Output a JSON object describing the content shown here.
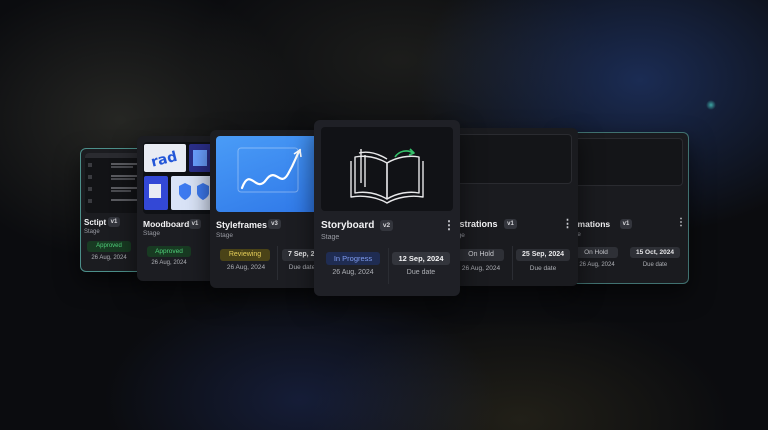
{
  "cards": {
    "script": {
      "title": "Sctipt",
      "version": "v1",
      "stage": "Stage",
      "status": "Approved",
      "date": "26 Aug, 2024"
    },
    "moodboard": {
      "title": "Moodboard",
      "version": "v1",
      "stage": "Stage",
      "status": "Approved",
      "date": "26 Aug, 2024"
    },
    "styleframes": {
      "title": "Styleframes",
      "version": "v3",
      "stage": "Stage",
      "status": "Reviewing",
      "date": "26 Aug, 2024",
      "due_value": "7 Sep, 2",
      "due_label": "Due date"
    },
    "storyboard": {
      "title": "Storyboard",
      "version": "v2",
      "stage": "Stage",
      "status": "In Progress",
      "date": "26 Aug, 2024",
      "due_value": "12 Sep, 2024",
      "due_label": "Due date"
    },
    "illustrations": {
      "title": "ustrations",
      "version": "v1",
      "stage": "age",
      "status": "On Hold",
      "date": "26 Aug, 2024",
      "due_value": "25 Sep, 2024",
      "due_label": "Due date"
    },
    "animations": {
      "title": "nimations",
      "version": "v1",
      "stage": "age",
      "status": "On Hold",
      "date": "26 Aug, 2024",
      "due_value": "15 Oct, 2024",
      "due_label": "Due date"
    }
  },
  "colors": {
    "approved_bg": "#183a22",
    "approved_text": "#4fd07a",
    "reviewing_bg": "#4a4317",
    "reviewing_text": "#e6cf5a",
    "progress_bg": "#1f2c52",
    "progress_text": "#7f9cf0",
    "hold_bg": "#2e3036",
    "hold_text": "#c8c9ce",
    "styleframe_blue": "#3d8af0"
  },
  "icons": {
    "menu": "kebab-icon",
    "storyboard_thumb": "open-book-icon"
  }
}
